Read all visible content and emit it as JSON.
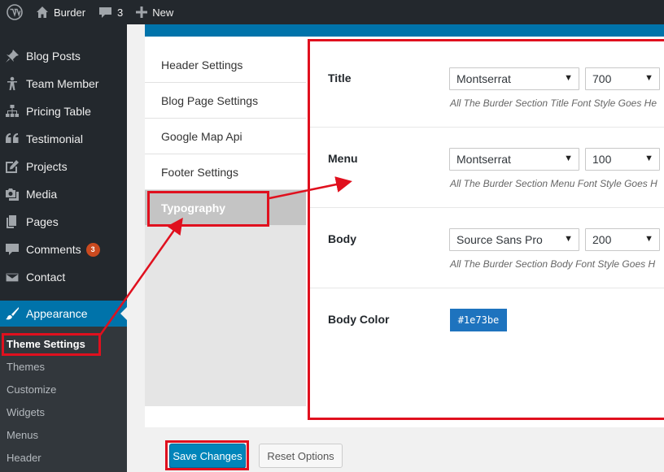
{
  "admin_bar": {
    "site_name": "Burder",
    "comments_count": "3",
    "new_label": "New"
  },
  "sidebar": {
    "items": [
      {
        "label": "Blog Posts",
        "icon": "pin-icon"
      },
      {
        "label": "Team Member",
        "icon": "person-icon"
      },
      {
        "label": "Pricing Table",
        "icon": "sitemap-icon"
      },
      {
        "label": "Testimonial",
        "icon": "quote-icon"
      },
      {
        "label": "Projects",
        "icon": "edit-icon"
      },
      {
        "label": "Media",
        "icon": "media-icon"
      },
      {
        "label": "Pages",
        "icon": "pages-icon"
      },
      {
        "label": "Comments",
        "icon": "comment-icon",
        "badge": "3"
      },
      {
        "label": "Contact",
        "icon": "mail-icon"
      }
    ],
    "appearance_label": "Appearance",
    "submenu": [
      "Theme Settings",
      "Themes",
      "Customize",
      "Widgets",
      "Menus",
      "Header"
    ]
  },
  "tabs": [
    "Header Settings",
    "Blog Page Settings",
    "Google Map Api",
    "Footer Settings",
    "Typography"
  ],
  "typography": {
    "title": {
      "label": "Title",
      "font": "Montserrat",
      "weight": "700",
      "desc": "All The Burder Section Title Font Style Goes He"
    },
    "menu": {
      "label": "Menu",
      "font": "Montserrat",
      "weight": "100",
      "desc": "All The Burder Section Menu Font Style Goes H"
    },
    "body": {
      "label": "Body",
      "font": "Source Sans Pro",
      "weight": "200",
      "desc": "All The Burder Section Body Font Style Goes H"
    },
    "body_color": {
      "label": "Body Color",
      "value": "#1e73be"
    }
  },
  "buttons": {
    "save": "Save Changes",
    "reset": "Reset Options"
  },
  "colors": {
    "accent": "#0073aa",
    "highlight": "#e0101e",
    "body_color_chip": "#1e73be"
  }
}
